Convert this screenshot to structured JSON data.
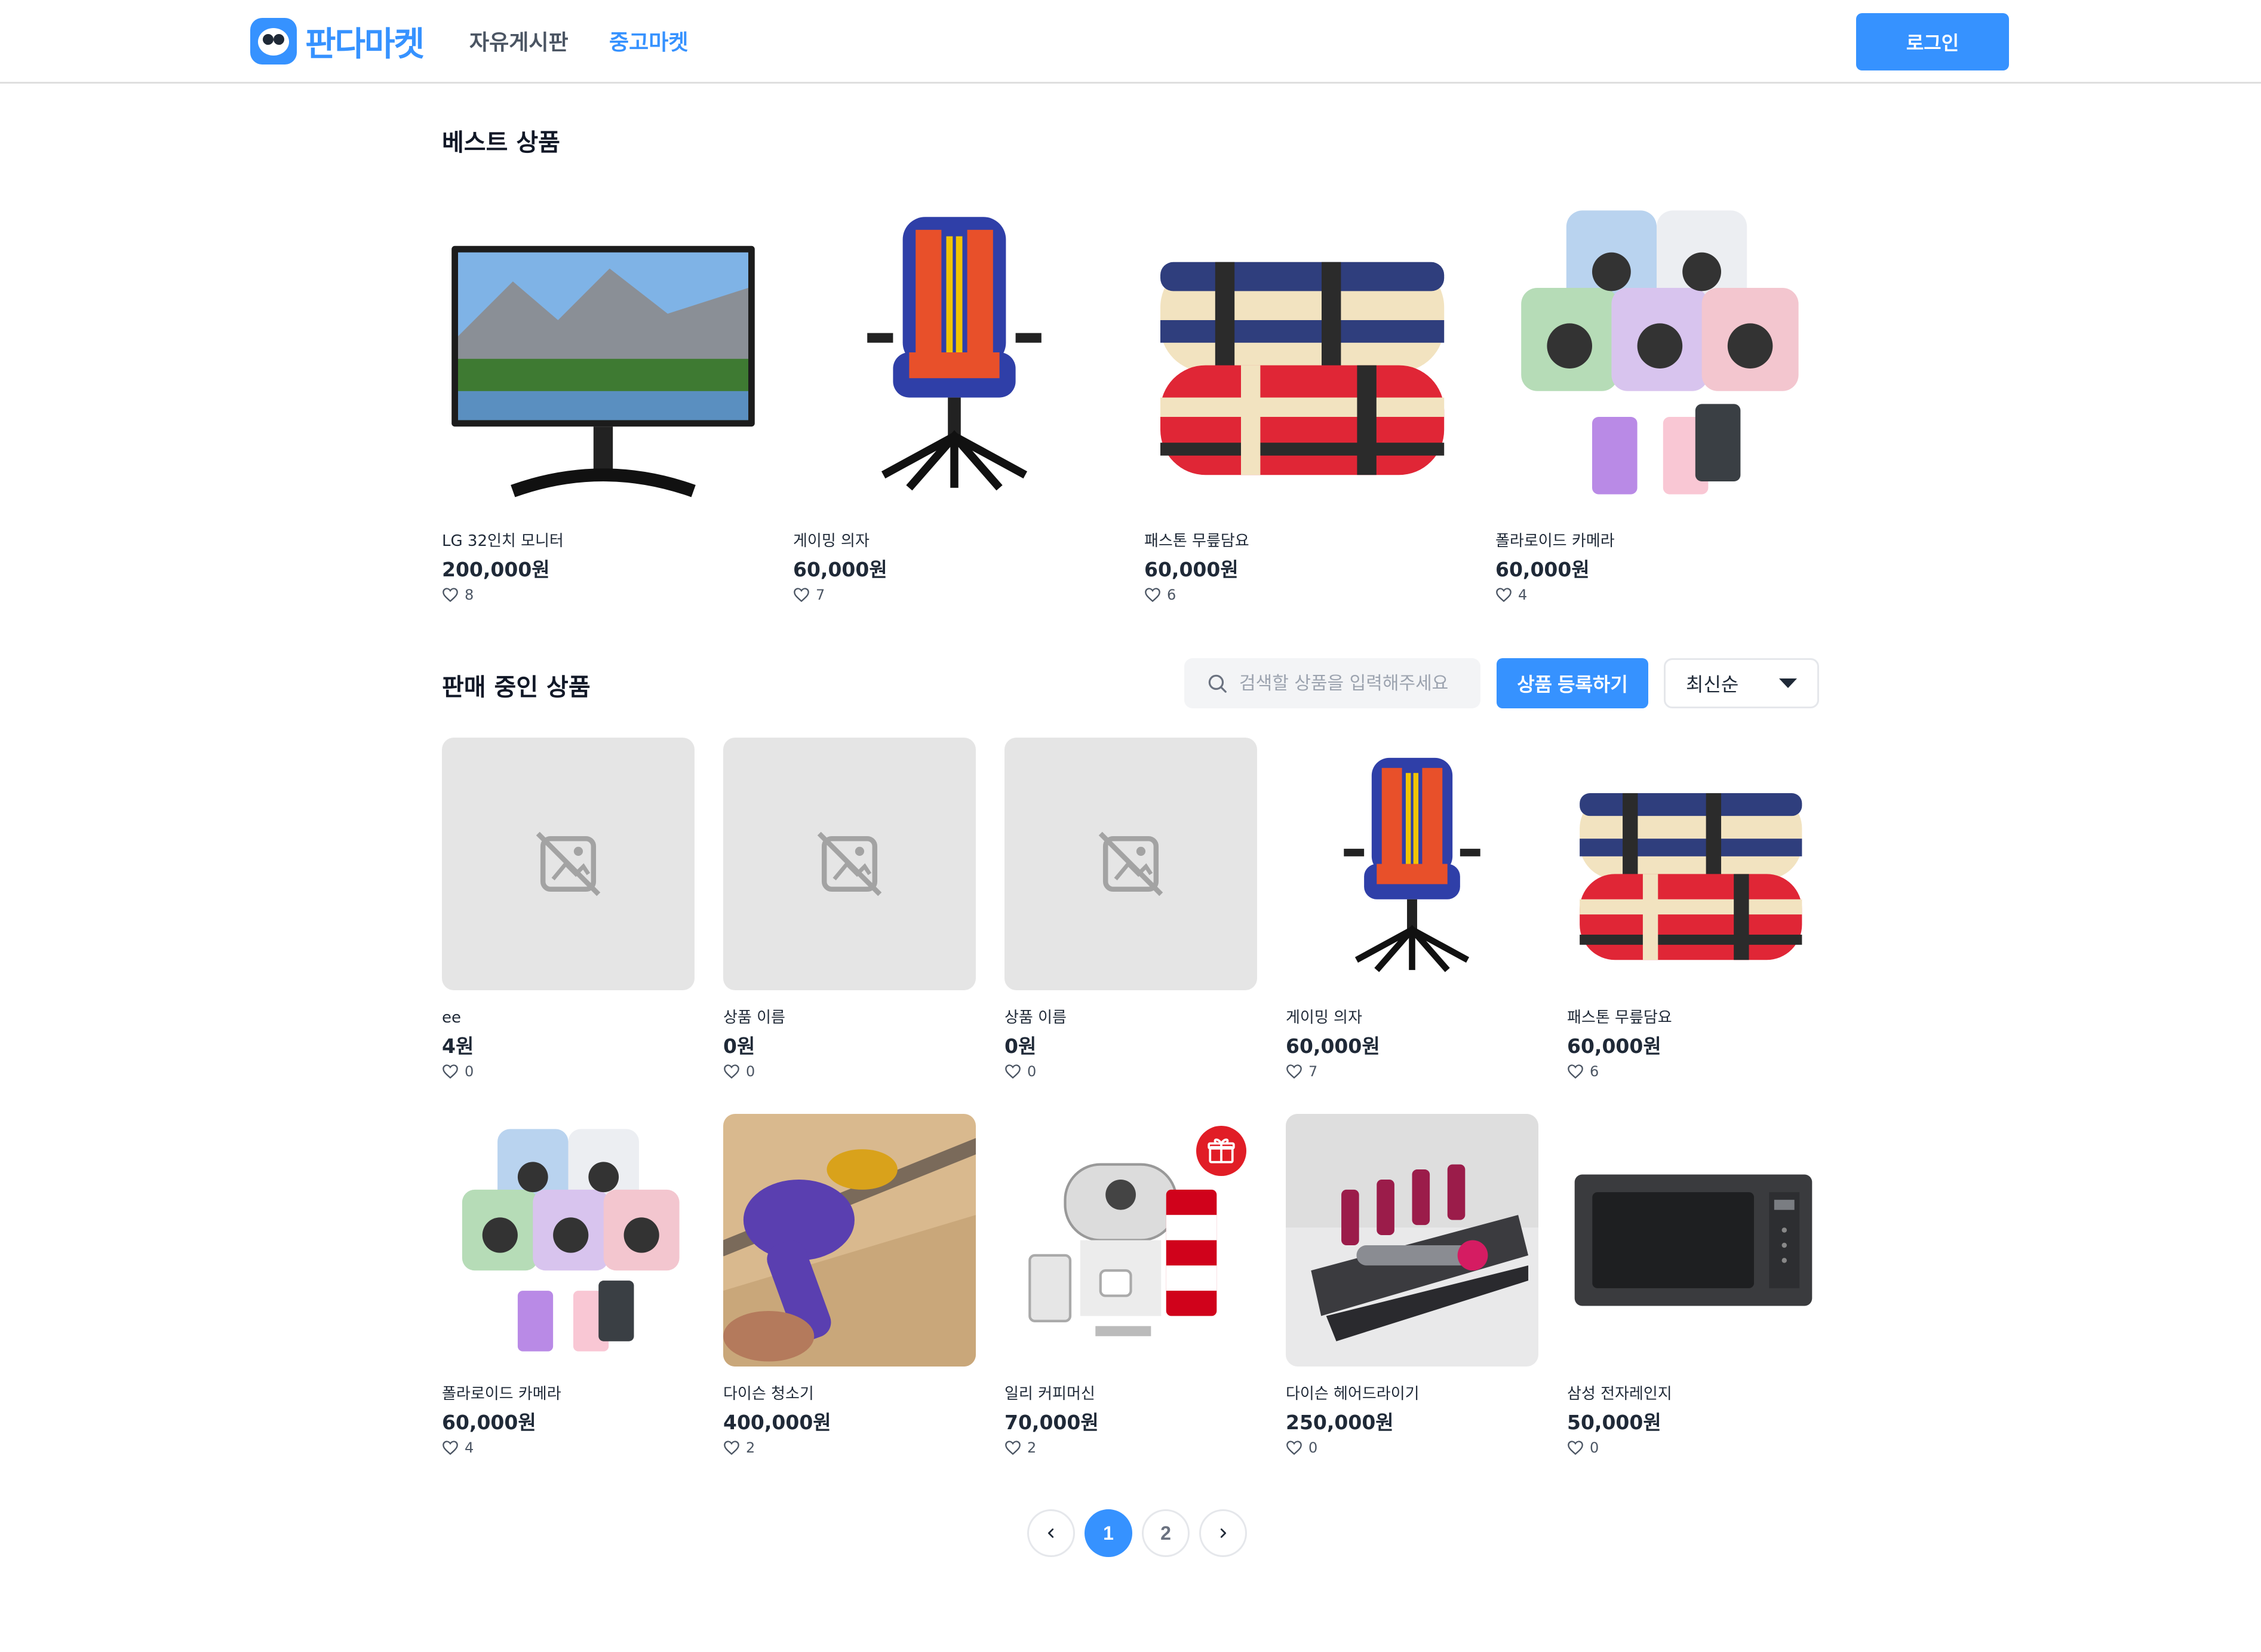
{
  "header": {
    "logo_text": "판다마켓",
    "nav": [
      "자유게시판",
      "중고마켓"
    ],
    "active_nav": "중고마켓",
    "login_label": "로그인"
  },
  "best": {
    "title": "베스트 상품",
    "items": [
      {
        "name": "LG 32인치 모니터",
        "price": "200,000원",
        "likes": "8",
        "image": "monitor"
      },
      {
        "name": "게이밍 의자",
        "price": "60,000원",
        "likes": "7",
        "image": "gaming-chair"
      },
      {
        "name": "패스톤 무릎담요",
        "price": "60,000원",
        "likes": "6",
        "image": "blanket"
      },
      {
        "name": "폴라로이드 카메라",
        "price": "60,000원",
        "likes": "4",
        "image": "instax-camera"
      }
    ]
  },
  "onsale": {
    "title": "판매 중인 상품",
    "search_placeholder": "검색할 상품을 입력해주세요",
    "register_label": "상품 등록하기",
    "sort_value": "최신순",
    "items": [
      {
        "name": "ee",
        "price": "4원",
        "likes": "0",
        "image": "placeholder"
      },
      {
        "name": "상품 이름",
        "price": "0원",
        "likes": "0",
        "image": "placeholder"
      },
      {
        "name": "상품 이름",
        "price": "0원",
        "likes": "0",
        "image": "placeholder"
      },
      {
        "name": "게이밍 의자",
        "price": "60,000원",
        "likes": "7",
        "image": "gaming-chair"
      },
      {
        "name": "패스톤 무릎담요",
        "price": "60,000원",
        "likes": "6",
        "image": "blanket"
      },
      {
        "name": "폴라로이드 카메라",
        "price": "60,000원",
        "likes": "4",
        "image": "instax-camera"
      },
      {
        "name": "다이슨 청소기",
        "price": "400,000원",
        "likes": "2",
        "image": "vacuum"
      },
      {
        "name": "일리 커피머신",
        "price": "70,000원",
        "likes": "2",
        "image": "coffee-machine"
      },
      {
        "name": "다이슨 헤어드라이기",
        "price": "250,000원",
        "likes": "0",
        "image": "hair-dryer"
      },
      {
        "name": "삼성 전자레인지",
        "price": "50,000원",
        "likes": "0",
        "image": "microwave"
      }
    ]
  },
  "pagination": {
    "pages": [
      "1",
      "2"
    ],
    "current": "1"
  },
  "colors": {
    "brand": "#3692ff",
    "placeholder_bg": "#e5e5e5",
    "gift_badge": "#e11d26"
  }
}
